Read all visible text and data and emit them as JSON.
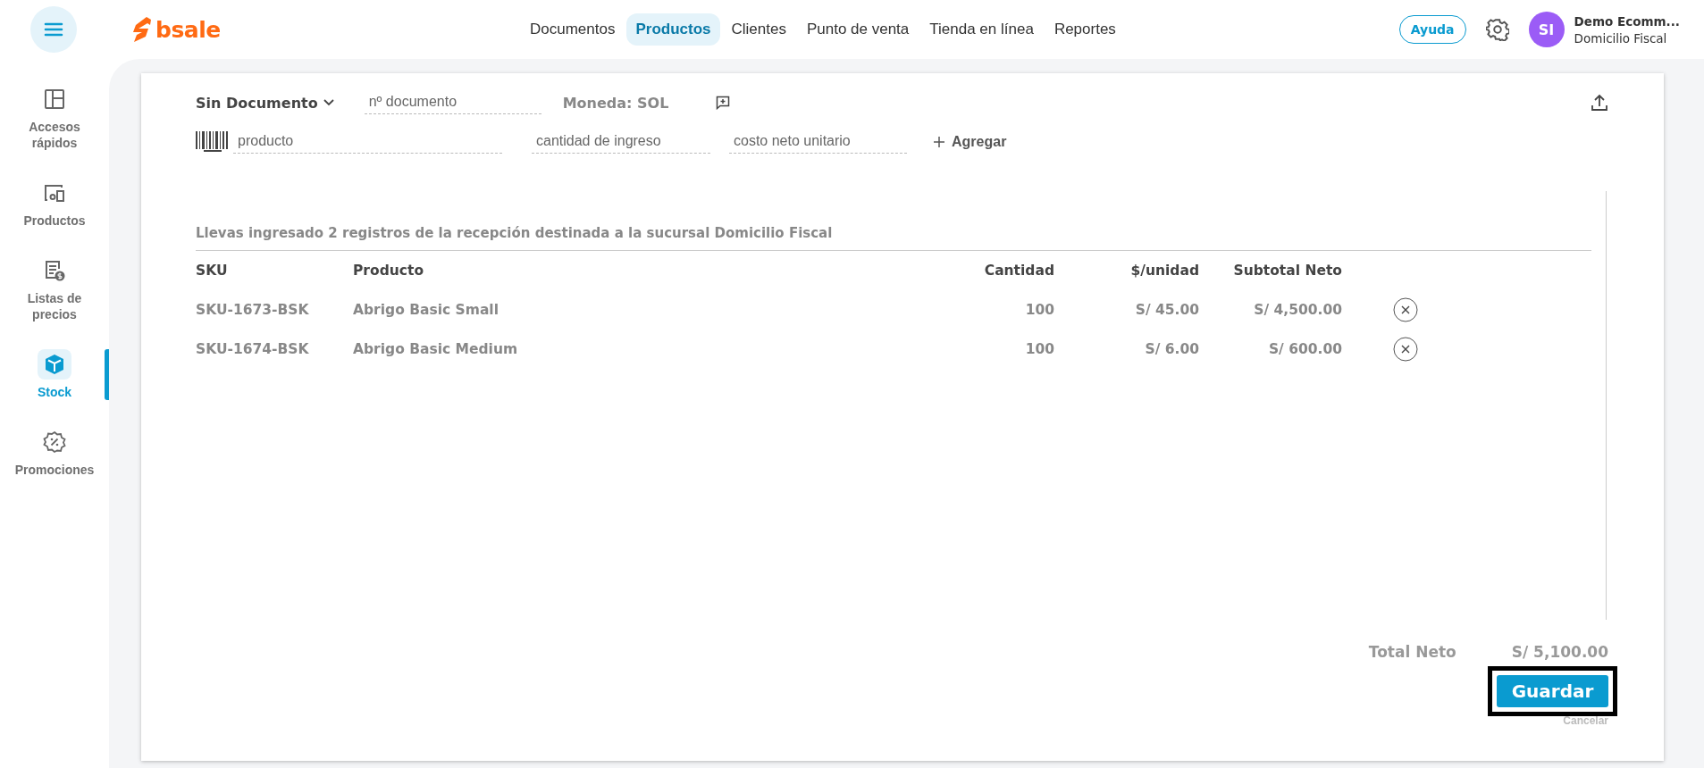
{
  "topbar": {
    "logo": "bsale",
    "nav": [
      {
        "label": "Documentos",
        "selected": false
      },
      {
        "label": "Productos",
        "selected": true
      },
      {
        "label": "Clientes",
        "selected": false
      },
      {
        "label": "Punto de venta",
        "selected": false
      },
      {
        "label": "Tienda en línea",
        "selected": false
      },
      {
        "label": "Reportes",
        "selected": false
      }
    ],
    "help": "Ayuda",
    "user": {
      "initials": "SI",
      "name": "Demo Ecomm...",
      "branch": "Domicilio Fiscal"
    }
  },
  "sidebar": {
    "items": [
      {
        "label": "Accesos rápidos",
        "selected": false
      },
      {
        "label": "Productos",
        "selected": false
      },
      {
        "label": "Listas de precios",
        "selected": false
      },
      {
        "label": "Stock",
        "selected": true
      },
      {
        "label": "Promociones",
        "selected": false
      }
    ]
  },
  "form": {
    "document_type": "Sin Documento",
    "document_number": {
      "placeholder": "nº documento"
    },
    "currency": "Moneda: SOL",
    "product": {
      "placeholder": "producto"
    },
    "quantity": {
      "placeholder": "cantidad de ingreso"
    },
    "unit_cost": {
      "placeholder": "costo neto unitario"
    },
    "add_button": "Agregar"
  },
  "summary": "Llevas ingresado 2 registros de la recepción destinada a la sucursal Domicilio Fiscal",
  "table": {
    "columns": [
      "SKU",
      "Producto",
      "Cantidad",
      "$/unidad",
      "Subtotal Neto"
    ],
    "rows": [
      {
        "cells": [
          "SKU-1673-BSK",
          "Abrigo Basic Small",
          "100",
          "S/ 45.00",
          "S/ 4,500.00"
        ]
      },
      {
        "cells": [
          "SKU-1674-BSK",
          "Abrigo Basic Medium",
          "100",
          "S/ 6.00",
          "S/ 600.00"
        ]
      }
    ]
  },
  "total": {
    "label": "Total Neto",
    "value": "S/ 5,100.00"
  },
  "save_button": {
    "label": "Guardar",
    "highlighted": true
  },
  "cancel_link": "Cancelar"
}
